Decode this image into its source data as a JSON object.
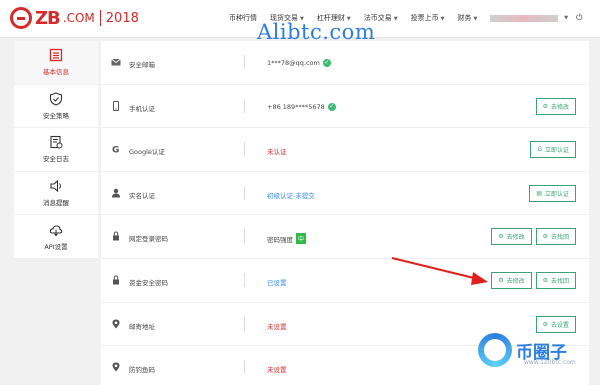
{
  "header": {
    "logo_zb": "ZB",
    "logo_dotcom": ".COM",
    "logo_year": "2018",
    "nav": [
      {
        "label": "币种行情",
        "caret": false
      },
      {
        "label": "现货交易",
        "caret": true
      },
      {
        "label": "杠杆理财",
        "caret": true
      },
      {
        "label": "法币交易",
        "caret": true
      },
      {
        "label": "投票上币",
        "caret": true
      },
      {
        "label": "财务",
        "caret": true
      }
    ],
    "logout_icon": "logout-icon"
  },
  "watermark": "Alibtc.com",
  "sidebar": {
    "items": [
      {
        "label": "基本信息",
        "icon": "profile-icon",
        "active": true
      },
      {
        "label": "安全策略",
        "icon": "shield-icon",
        "active": false
      },
      {
        "label": "安全日志",
        "icon": "log-icon",
        "active": false
      },
      {
        "label": "消息提醒",
        "icon": "speaker-icon",
        "active": false
      },
      {
        "label": "API设置",
        "icon": "cloud-api-icon",
        "active": false
      }
    ]
  },
  "rows": [
    {
      "label": "安全邮箱",
      "icon": "mail-icon",
      "value": "1***78@qq.com",
      "verified": true,
      "style": ""
    },
    {
      "label": "手机认证",
      "icon": "phone-icon",
      "value": "+86 189****5678",
      "verified": true,
      "style": "",
      "buttons": [
        "去修改"
      ]
    },
    {
      "label": "Google认证",
      "icon": "google-icon",
      "value": "未认证",
      "style": "red",
      "buttons": [
        "立即认证"
      ]
    },
    {
      "label": "实名认证",
      "icon": "person-icon",
      "value": "初级认证-未提交",
      "style": "blue",
      "buttons": [
        "立即认证"
      ]
    },
    {
      "label": "网定登录密码",
      "icon": "lock-icon",
      "value": "密码强度",
      "strength": "中",
      "style": "",
      "buttons": [
        "去修改",
        "去找回"
      ]
    },
    {
      "label": "资金安全密码",
      "icon": "lock-icon",
      "value": "已设置",
      "style": "blue",
      "buttons": [
        "去修改",
        "去找回"
      ]
    },
    {
      "label": "邮寄地址",
      "icon": "location-icon",
      "value": "未设置",
      "style": "red",
      "buttons": [
        "去设置"
      ]
    },
    {
      "label": "防钓鱼码",
      "icon": "location-icon",
      "value": "未设置",
      "style": "red",
      "buttons": []
    }
  ],
  "brand": {
    "name": "币圈子",
    "url": "www.120btc.com"
  },
  "colors": {
    "accent_red": "#d62a2a",
    "button_green": "#3aa572",
    "link_blue": "#3a8ee6",
    "arrow_red": "#e0201b"
  }
}
